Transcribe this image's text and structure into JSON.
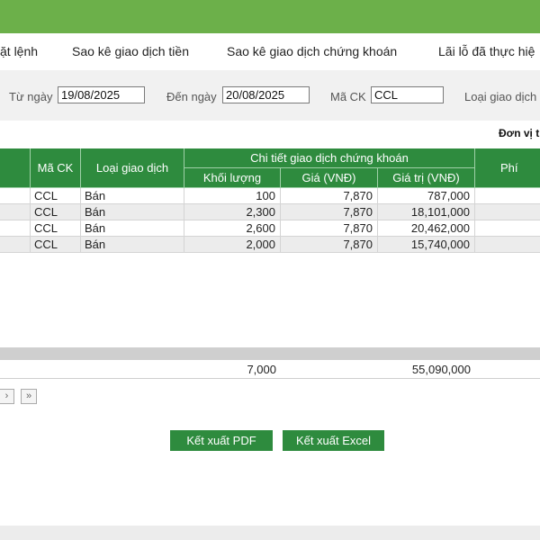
{
  "tabs": [
    "ặt lệnh",
    "Sao kê giao dịch tiền",
    "Sao kê giao dịch chứng khoán",
    "Lãi lỗ đã thực hiệ"
  ],
  "filters": {
    "from_label": "Từ ngày",
    "from_value": "19/08/2025",
    "to_label": "Đến ngày",
    "to_value": "20/08/2025",
    "code_label": "Mã CK",
    "code_value": "CCL",
    "type_label": "Loại giao dịch"
  },
  "unit_label": "Đơn vị t",
  "table": {
    "headers": {
      "code": "Mã CK",
      "type": "Loại giao dịch",
      "detail_group": "Chi tiết giao dịch chứng khoán",
      "volume": "Khối lượng",
      "price": "Giá (VNĐ)",
      "value": "Giá trị (VNĐ)",
      "fee": "Phí (VN"
    },
    "rows": [
      {
        "code": "CCL",
        "type": "Bán",
        "volume": "100",
        "price": "7,870",
        "value": "787,000"
      },
      {
        "code": "CCL",
        "type": "Bán",
        "volume": "2,300",
        "price": "7,870",
        "value": "18,101,000"
      },
      {
        "code": "CCL",
        "type": "Bán",
        "volume": "2,600",
        "price": "7,870",
        "value": "20,462,000"
      },
      {
        "code": "CCL",
        "type": "Bán",
        "volume": "2,000",
        "price": "7,870",
        "value": "15,740,000"
      }
    ],
    "totals": {
      "volume": "7,000",
      "value": "55,090,000"
    }
  },
  "pager": {
    "next": "›",
    "last": "»"
  },
  "buttons": {
    "pdf": "Kết xuất PDF",
    "excel": "Kết xuất Excel"
  },
  "colors": {
    "header_green": "#2e8b3e",
    "top_green": "#6cb04a"
  }
}
